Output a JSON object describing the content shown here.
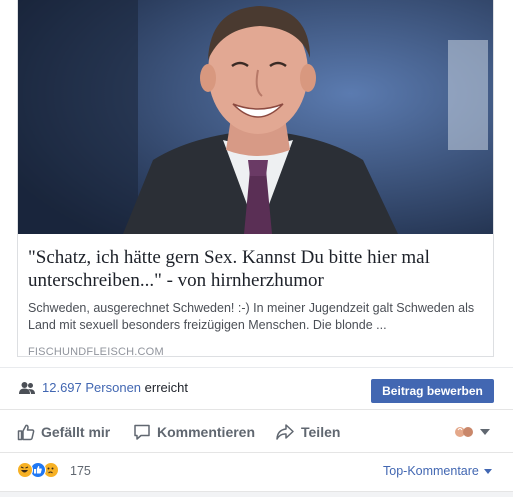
{
  "link_card": {
    "title": "\"Schatz, ich hätte gern Sex. Kannst Du bitte hier mal unterschreiben...\" - von hirnherzhumor",
    "description": "Schweden, ausgerechnet Schweden! :-) In meiner Jugendzeit galt Schweden als Land mit sexuell besonders freizügigen Menschen. Die blonde ...",
    "domain": "FISCHUNDFLEISCH.COM"
  },
  "reach": {
    "count": "12.697 Personen",
    "suffix": "erreicht",
    "boost_label": "Beitrag bewerben"
  },
  "actions": {
    "like": "Gefällt mir",
    "comment": "Kommentieren",
    "share": "Teilen"
  },
  "reactions": {
    "count": "175",
    "top_comments": "Top-Kommentare"
  },
  "colors": {
    "brand_blue": "#4267b2",
    "action_gray": "#606770"
  }
}
